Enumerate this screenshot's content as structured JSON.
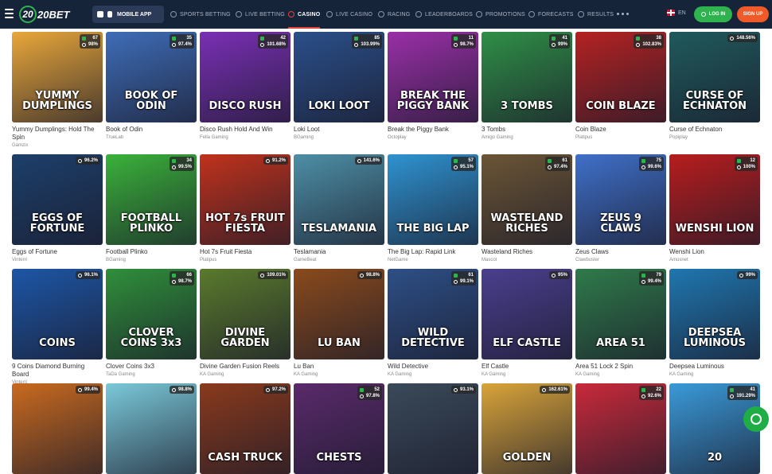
{
  "header": {
    "logo": "20BET",
    "mobile_app": "MOBILE APP",
    "nav": [
      {
        "label": "SPORTS BETTING",
        "icon": "ball-icon"
      },
      {
        "label": "LIVE BETTING",
        "icon": "live-icon"
      },
      {
        "label": "CASINO",
        "icon": "casino-chip-icon",
        "active": true
      },
      {
        "label": "LIVE CASINO",
        "icon": "cards-icon"
      },
      {
        "label": "RACING",
        "icon": "horse-icon"
      },
      {
        "label": "LEADERBOARDS",
        "icon": "trophy-icon"
      },
      {
        "label": "PROMOTIONS",
        "icon": "gift-icon"
      },
      {
        "label": "FORECASTS",
        "icon": "chart-icon"
      },
      {
        "label": "RESULTS",
        "icon": "results-icon"
      }
    ],
    "language": "EN",
    "login": "LOG IN",
    "signup": "SIGN UP"
  },
  "games": [
    {
      "name": "Yummy Dumplings: Hold The Spin",
      "provider": "Gamzix",
      "title": "YUMMY DUMPLINGS",
      "count": "67",
      "rtp": "98%",
      "bg": "#e9a73a"
    },
    {
      "name": "Book of Odin",
      "provider": "TrueLab",
      "title": "BOOK OF ODIN",
      "count": "35",
      "rtp": "97.4%",
      "bg": "#3e6db8"
    },
    {
      "name": "Disco Rush Hold And Win",
      "provider": "Fella Gaming",
      "title": "DISCO RUSH",
      "count": "42",
      "rtp": "101.68%",
      "bg": "#7a2fb5"
    },
    {
      "name": "Loki Loot",
      "provider": "BGaming",
      "title": "LOKI LOOT",
      "count": "85",
      "rtp": "103.99%",
      "bg": "#2a4f8a"
    },
    {
      "name": "Break the Piggy Bank",
      "provider": "Octoplay",
      "title": "BREAK THE PIGGY BANK",
      "count": "11",
      "rtp": "98.7%",
      "bg": "#9a2fa8"
    },
    {
      "name": "3 Tombs",
      "provider": "Amigo Gaming",
      "title": "3 TOMBS",
      "count": "41",
      "rtp": "99%",
      "bg": "#2f8f47"
    },
    {
      "name": "Coin Blaze",
      "provider": "Platipus",
      "title": "COIN BLAZE",
      "count": "38",
      "rtp": "102.83%",
      "bg": "#b52222"
    },
    {
      "name": "Curse of Echnaton",
      "provider": "Popiplay",
      "title": "CURSE OF ECHNATON",
      "count": "",
      "rtp": "148.56%",
      "bg": "#1f5a5c"
    },
    {
      "name": "Eggs of Fortune",
      "provider": "Vinterri",
      "title": "EGGS OF FORTUNE",
      "count": "",
      "rtp": "96.2%",
      "bg": "#1d3f6b"
    },
    {
      "name": "Football Plinko",
      "provider": "BGaming",
      "title": "FOOTBALL PLINKO",
      "count": "34",
      "rtp": "99.5%",
      "bg": "#3ab23a"
    },
    {
      "name": "Hot 7s Fruit Fiesta",
      "provider": "Platipus",
      "title": "HOT 7s FRUIT FIESTA",
      "count": "",
      "rtp": "91.2%",
      "bg": "#c0321c"
    },
    {
      "name": "Teslamania",
      "provider": "GameBeat",
      "title": "TESLAMANIA",
      "count": "",
      "rtp": "141.6%",
      "bg": "#4d8fa6"
    },
    {
      "name": "The Big Lap: Rapid Link",
      "provider": "NetGame",
      "title": "THE BIG LAP",
      "count": "57",
      "rtp": "95.1%",
      "bg": "#2e93d1"
    },
    {
      "name": "Wasteland Riches",
      "provider": "Mascot",
      "title": "WASTELAND RICHES",
      "count": "61",
      "rtp": "97.4%",
      "bg": "#6b5535"
    },
    {
      "name": "Zeus Claws",
      "provider": "Clawbuster",
      "title": "ZEUS 9 CLAWS",
      "count": "75",
      "rtp": "99.6%",
      "bg": "#3f70c9"
    },
    {
      "name": "Wenshi Lion",
      "provider": "Amusnet",
      "title": "WENSHI LION",
      "count": "12",
      "rtp": "100%",
      "bg": "#b81d1d"
    },
    {
      "name": "9 Coins Diamond Burning Board",
      "provider": "Vinterri",
      "title": "COINS",
      "count": "",
      "rtp": "96.1%",
      "bg": "#1d56a6"
    },
    {
      "name": "Clover Coins 3x3",
      "provider": "TaDa Gaming",
      "title": "CLOVER COINS 3x3",
      "count": "66",
      "rtp": "98.7%",
      "bg": "#2f8f3a"
    },
    {
      "name": "Divine Garden Fusion Reels",
      "provider": "KA Gaming",
      "title": "DIVINE GARDEN",
      "count": "",
      "rtp": "109.01%",
      "bg": "#5a7a2c"
    },
    {
      "name": "Lu Ban",
      "provider": "KA Gaming",
      "title": "LU BAN",
      "count": "",
      "rtp": "98.8%",
      "bg": "#8a4a1c"
    },
    {
      "name": "Wild Detective",
      "provider": "KA Gaming",
      "title": "WILD DETECTIVE",
      "count": "61",
      "rtp": "99.1%",
      "bg": "#2d4f86"
    },
    {
      "name": "Elf Castle",
      "provider": "KA Gaming",
      "title": "ELF CASTLE",
      "count": "",
      "rtp": "95%",
      "bg": "#4a3f8e"
    },
    {
      "name": "Area 51 Lock 2 Spin",
      "provider": "KA Gaming",
      "title": "AREA 51",
      "count": "79",
      "rtp": "99.4%",
      "bg": "#2f7a4a"
    },
    {
      "name": "Deepsea Luminous",
      "provider": "KA Gaming",
      "title": "DEEPSEA LUMINOUS",
      "count": "",
      "rtp": "99%",
      "bg": "#1f77b0"
    },
    {
      "name": "",
      "provider": "",
      "title": "",
      "count": "",
      "rtp": "99.4%",
      "bg": "#c96a1f"
    },
    {
      "name": "",
      "provider": "",
      "title": "",
      "count": "",
      "rtp": "98.8%",
      "bg": "#7ac9d9"
    },
    {
      "name": "",
      "provider": "",
      "title": "CASH TRUCK",
      "count": "",
      "rtp": "97.2%",
      "bg": "#8a3a1c"
    },
    {
      "name": "",
      "provider": "",
      "title": "CHESTS",
      "count": "52",
      "rtp": "97.8%",
      "bg": "#5a2a6b"
    },
    {
      "name": "",
      "provider": "",
      "title": "",
      "count": "",
      "rtp": "93.1%",
      "bg": "#3a4a5a"
    },
    {
      "name": "",
      "provider": "",
      "title": "GOLDEN",
      "count": "",
      "rtp": "162.61%",
      "bg": "#d9a43a"
    },
    {
      "name": "",
      "provider": "",
      "title": "",
      "count": "22",
      "rtp": "92.6%",
      "bg": "#c92a3a"
    },
    {
      "name": "",
      "provider": "",
      "title": "20",
      "count": "41",
      "rtp": "191.29%",
      "bg": "#3a9ad9"
    }
  ],
  "chat": {
    "icon": "chat-icon"
  }
}
